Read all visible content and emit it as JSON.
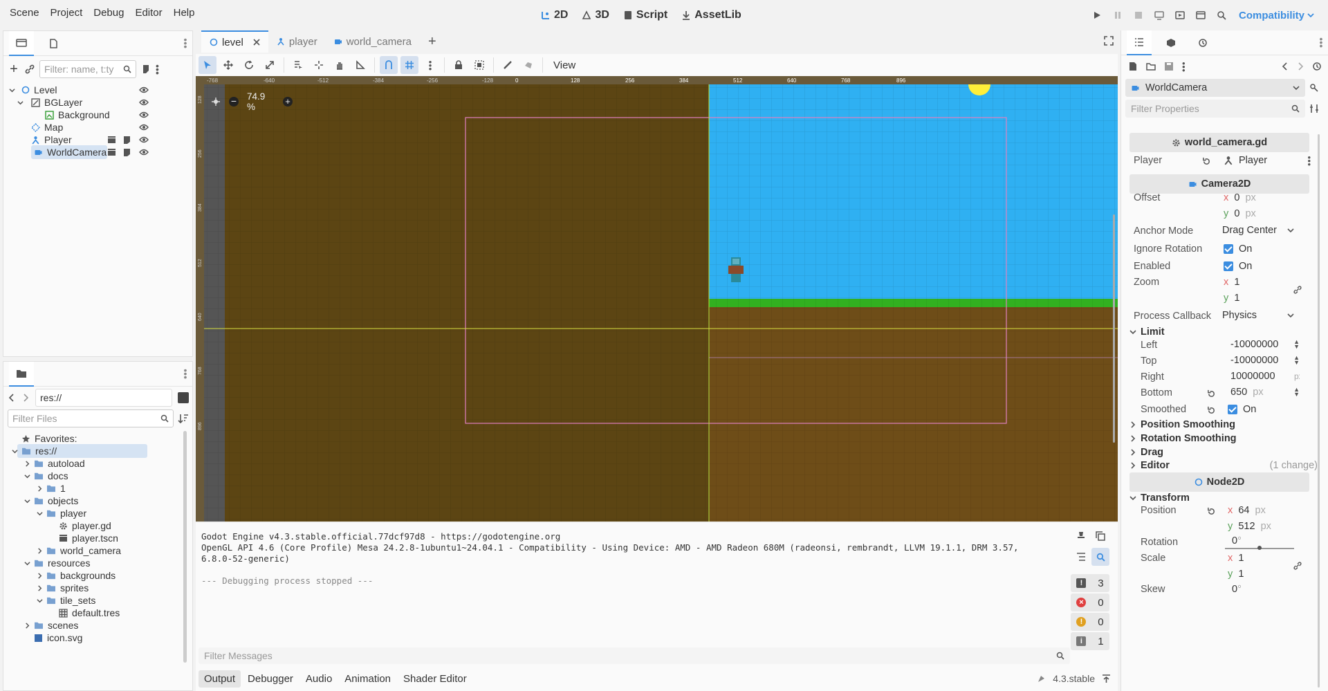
{
  "menu": {
    "items": [
      "Scene",
      "Project",
      "Debug",
      "Editor",
      "Help"
    ]
  },
  "workspaces": [
    {
      "label": "2D",
      "active": true
    },
    {
      "label": "3D"
    },
    {
      "label": "Script"
    },
    {
      "label": "AssetLib"
    }
  ],
  "renderer": "Compatibility",
  "scene_dock": {
    "filter_placeholder": "Filter: name, t:ty",
    "nodes": [
      {
        "label": "Level",
        "icon": "node2d-icon"
      },
      {
        "label": "BGLayer",
        "icon": "canvas-layer-icon"
      },
      {
        "label": "Background",
        "icon": "texture-rect-icon"
      },
      {
        "label": "Map",
        "icon": "tilemap-icon"
      },
      {
        "label": "Player",
        "icon": "character-icon"
      },
      {
        "label": "WorldCamera",
        "icon": "camera-icon",
        "selected": true
      }
    ]
  },
  "filesystem": {
    "path": "res://",
    "filter_placeholder": "Filter Files",
    "items": [
      {
        "label": "Favorites:",
        "icon": "star-icon",
        "depth": 0
      },
      {
        "label": "res://",
        "icon": "folder-icon",
        "depth": 0,
        "selected": true
      },
      {
        "label": "autoload",
        "icon": "folder-icon",
        "depth": 1
      },
      {
        "label": "docs",
        "icon": "folder-icon",
        "depth": 1
      },
      {
        "label": "1",
        "icon": "folder-icon",
        "depth": 2
      },
      {
        "label": "objects",
        "icon": "folder-icon",
        "depth": 1
      },
      {
        "label": "player",
        "icon": "folder-icon",
        "depth": 2
      },
      {
        "label": "player.gd",
        "icon": "gear-icon",
        "depth": 3
      },
      {
        "label": "player.tscn",
        "icon": "scene-icon",
        "depth": 3
      },
      {
        "label": "world_camera",
        "icon": "folder-icon",
        "depth": 2
      },
      {
        "label": "resources",
        "icon": "folder-icon",
        "depth": 1
      },
      {
        "label": "backgrounds",
        "icon": "folder-icon",
        "depth": 2
      },
      {
        "label": "sprites",
        "icon": "folder-icon",
        "depth": 2
      },
      {
        "label": "tile_sets",
        "icon": "folder-icon",
        "depth": 2
      },
      {
        "label": "default.tres",
        "icon": "tileset-icon",
        "depth": 3
      },
      {
        "label": "scenes",
        "icon": "folder-icon",
        "depth": 1
      },
      {
        "label": "icon.svg",
        "icon": "image-icon",
        "depth": 1
      }
    ]
  },
  "scene_tabs": [
    {
      "label": "level",
      "active": true
    },
    {
      "label": "player"
    },
    {
      "label": "world_camera"
    }
  ],
  "toolbar": {
    "view_label": "View"
  },
  "viewport": {
    "zoom": "74.9 %",
    "ruler_top": [
      "-768",
      "-640",
      "-512",
      "-384",
      "-256",
      "-128",
      "0",
      "128",
      "256",
      "384",
      "512",
      "640",
      "768",
      "896"
    ],
    "ruler_left": [
      "128",
      "256",
      "384",
      "512",
      "640",
      "768",
      "896"
    ]
  },
  "output": {
    "lines": [
      "Godot Engine v4.3.stable.official.77dcf97d8 - https://godotengine.org",
      "OpenGL API 4.6 (Core Profile) Mesa 24.2.8-1ubuntu1~24.04.1 - Compatibility - Using Device: AMD - AMD Radeon 680M (radeonsi, rembrandt, LLVM 19.1.1, DRM 3.57,",
      "6.8.0-52-generic)",
      "",
      "--- Debugging process stopped ---"
    ],
    "filter_placeholder": "Filter Messages",
    "counts": {
      "messages": "3",
      "errors": "0",
      "warnings": "0",
      "info": "1"
    },
    "tabs": [
      "Output",
      "Debugger",
      "Audio",
      "Animation",
      "Shader Editor"
    ],
    "version": "4.3.stable"
  },
  "inspector": {
    "node_name": "WorldCamera",
    "filter_placeholder": "Filter Properties",
    "script": "world_camera.gd",
    "player_label": "Player",
    "player_value": "Player",
    "camera_section": "Camera2D",
    "offset_label": "Offset",
    "offset_x": "0",
    "offset_y": "0",
    "anchor_label": "Anchor Mode",
    "anchor_value": "Drag Center",
    "ignore_rot_label": "Ignore Rotation",
    "ignore_rot_value": "On",
    "enabled_label": "Enabled",
    "enabled_value": "On",
    "zoom_label": "Zoom",
    "zoom_x": "1",
    "zoom_y": "1",
    "callback_label": "Process Callback",
    "callback_value": "Physics",
    "limit_label": "Limit",
    "left_label": "Left",
    "left_value": "-10000000",
    "top_label": "Top",
    "top_value": "-10000000",
    "right_label": "Right",
    "right_value": "10000000",
    "bottom_label": "Bottom",
    "bottom_value": "650",
    "smoothed_label": "Smoothed",
    "smoothed_value": "On",
    "pos_smoothing": "Position Smoothing",
    "rot_smoothing": "Rotation Smoothing",
    "drag": "Drag",
    "editor": "Editor",
    "editor_changes": "(1 change)",
    "node2d_section": "Node2D",
    "transform_label": "Transform",
    "position_label": "Position",
    "position_x": "64",
    "position_y": "512",
    "rotation_label": "Rotation",
    "rotation_value": "0",
    "scale_label": "Scale",
    "scale_x": "1",
    "scale_y": "1",
    "skew_label": "Skew",
    "skew_value": "0",
    "unit_px": "px",
    "unit_deg": "°",
    "axis_x": "x",
    "axis_y": "y"
  }
}
